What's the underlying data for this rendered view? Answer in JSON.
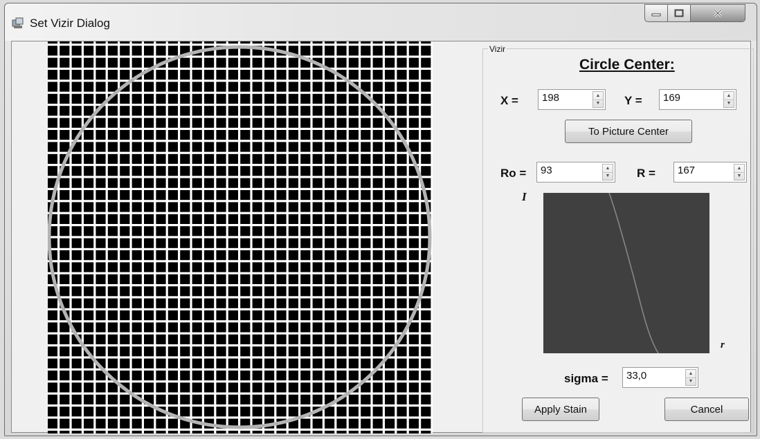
{
  "window": {
    "title": "Set Vizir Dialog",
    "icons": {
      "app": "app-icon",
      "minimize": "minimize-icon",
      "maximize": "maximize-icon",
      "close": "close-icon"
    }
  },
  "picture": {
    "description_icon": "grid-picture",
    "overlay_color": "#b4b4b4",
    "grid_color": "#ffffff",
    "background": "#000000"
  },
  "vizir": {
    "group_title": "Vizir",
    "heading": "Circle Center:",
    "x": {
      "label": "X =",
      "value": "198"
    },
    "y": {
      "label": "Y =",
      "value": "169"
    },
    "to_center_button": "To Picture Center",
    "ro": {
      "label": "Ro =",
      "value": "93"
    },
    "r": {
      "label": "R =",
      "value": "167"
    },
    "graph": {
      "y_axis_label": "I",
      "x_axis_label": "r",
      "background": "#404040",
      "curve_color": "#8a8a8a"
    },
    "sigma": {
      "label": "sigma =",
      "value": "33,0"
    },
    "apply_button": "Apply Stain",
    "cancel_button": "Cancel"
  }
}
